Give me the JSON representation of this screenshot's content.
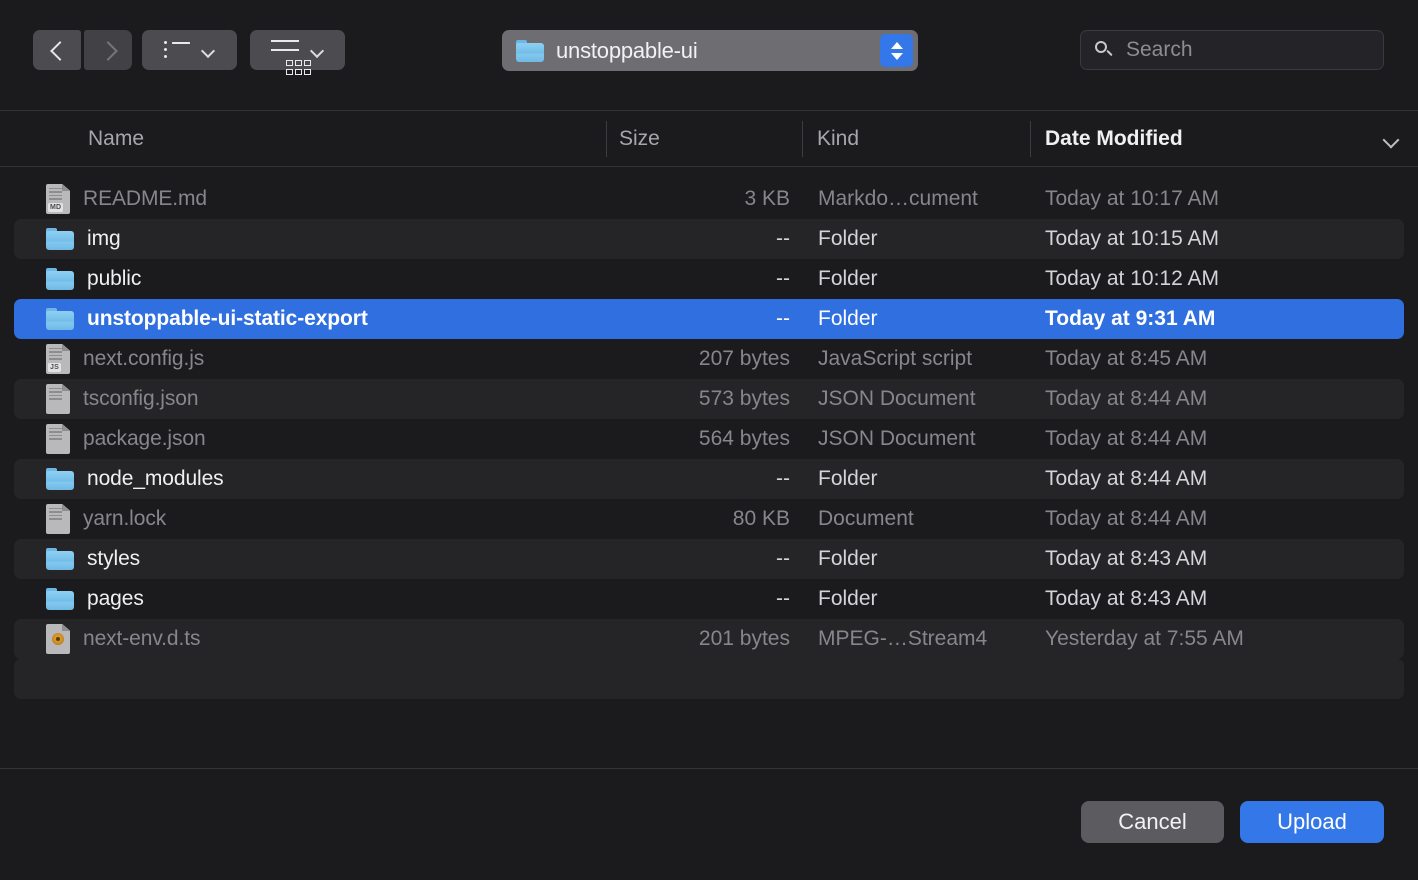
{
  "toolbar": {
    "back_button": {
      "name": "back",
      "icon": "chevron-left-icon",
      "enabled": true
    },
    "forward_button": {
      "name": "forward",
      "icon": "chevron-right-icon",
      "enabled": false
    },
    "list_view_button": {
      "icon": "list-view-icon",
      "dropdown_icon": "chevron-down-icon"
    },
    "icon_view_button": {
      "icon": "gallery-view-icon",
      "dropdown_icon": "chevron-down-icon"
    },
    "path_popup": {
      "label": "unstoppable-ui",
      "folder_icon": "folder-icon",
      "stepper_icon": "stepper-up-down-icon",
      "accent": "#3477e8"
    },
    "search": {
      "placeholder": "Search",
      "value": "",
      "icon": "search-icon"
    }
  },
  "columns": {
    "name": "Name",
    "size": "Size",
    "kind": "Kind",
    "date_modified": "Date Modified",
    "sort_by": "Date Modified",
    "sort_icon": "chevron-down-icon"
  },
  "files": [
    {
      "name": "README.md",
      "size": "3 KB",
      "kind": "Markdo…cument",
      "date": "Today at 10:17 AM",
      "icon": "document-icon",
      "badge": "MD",
      "type": "file",
      "enabled": false,
      "selected": false
    },
    {
      "name": "img",
      "size": "--",
      "kind": "Folder",
      "date": "Today at 10:15 AM",
      "icon": "folder-icon",
      "badge": "",
      "type": "folder",
      "enabled": true,
      "selected": false
    },
    {
      "name": "public",
      "size": "--",
      "kind": "Folder",
      "date": "Today at 10:12 AM",
      "icon": "folder-icon",
      "badge": "",
      "type": "folder",
      "enabled": true,
      "selected": false
    },
    {
      "name": "unstoppable-ui-static-export",
      "size": "--",
      "kind": "Folder",
      "date": "Today at 9:31 AM",
      "icon": "folder-icon",
      "badge": "",
      "type": "folder",
      "enabled": true,
      "selected": true
    },
    {
      "name": "next.config.js",
      "size": "207 bytes",
      "kind": "JavaScript script",
      "date": "Today at 8:45 AM",
      "icon": "document-icon",
      "badge": "JS",
      "type": "file",
      "enabled": false,
      "selected": false
    },
    {
      "name": "tsconfig.json",
      "size": "573 bytes",
      "kind": "JSON Document",
      "date": "Today at 8:44 AM",
      "icon": "document-icon",
      "badge": "",
      "type": "file",
      "enabled": false,
      "selected": false
    },
    {
      "name": "package.json",
      "size": "564 bytes",
      "kind": "JSON Document",
      "date": "Today at 8:44 AM",
      "icon": "document-icon",
      "badge": "",
      "type": "file",
      "enabled": false,
      "selected": false
    },
    {
      "name": "node_modules",
      "size": "--",
      "kind": "Folder",
      "date": "Today at 8:44 AM",
      "icon": "folder-icon",
      "badge": "",
      "type": "folder",
      "enabled": true,
      "selected": false
    },
    {
      "name": "yarn.lock",
      "size": "80 KB",
      "kind": "Document",
      "date": "Today at 8:44 AM",
      "icon": "document-icon",
      "badge": "",
      "type": "file",
      "enabled": false,
      "selected": false
    },
    {
      "name": "styles",
      "size": "--",
      "kind": "Folder",
      "date": "Today at 8:43 AM",
      "icon": "folder-icon",
      "badge": "",
      "type": "folder",
      "enabled": true,
      "selected": false
    },
    {
      "name": "pages",
      "size": "--",
      "kind": "Folder",
      "date": "Today at 8:43 AM",
      "icon": "folder-icon",
      "badge": "",
      "type": "folder",
      "enabled": true,
      "selected": false
    },
    {
      "name": "next-env.d.ts",
      "size": "201 bytes",
      "kind": "MPEG-…Stream4",
      "date": "Yesterday at 7:55 AM",
      "icon": "media-document-icon",
      "badge": "",
      "type": "media",
      "enabled": false,
      "selected": false
    }
  ],
  "footer": {
    "cancel_label": "Cancel",
    "upload_label": "Upload",
    "primary_color": "#3477e8"
  }
}
